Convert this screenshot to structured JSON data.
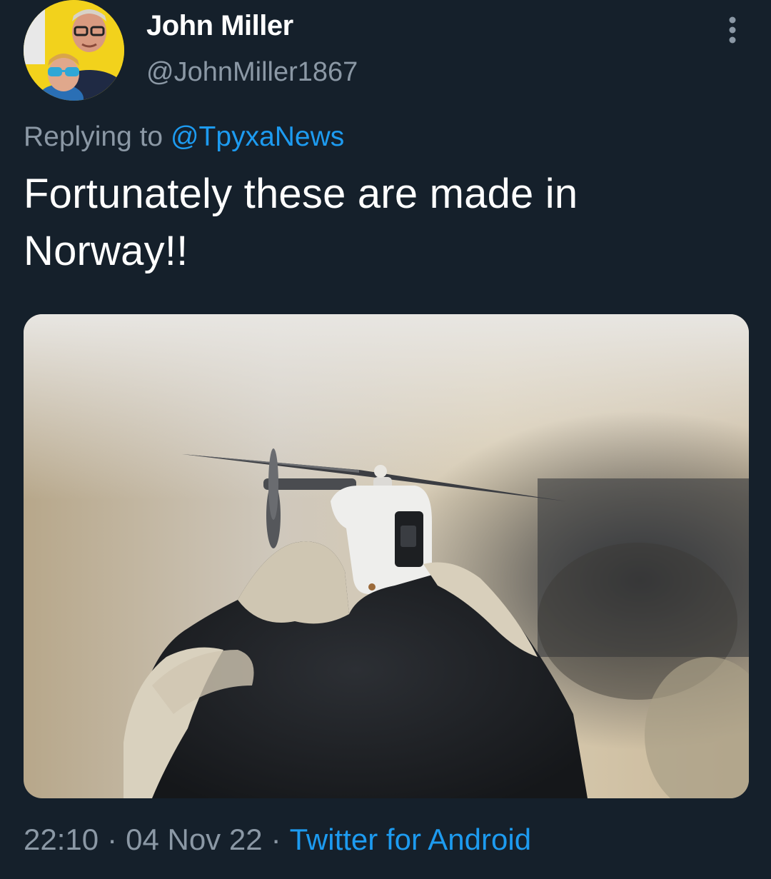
{
  "tweet": {
    "author": {
      "display_name": "John Miller",
      "handle": "@JohnMiller1867"
    },
    "replying_prefix": "Replying to",
    "replying_to": "@TpyxaNews",
    "text_line1": "Fortunately these are made in",
    "text_line2": "Norway!!",
    "time": "22:10",
    "separator": "·",
    "date": "04 Nov 22",
    "source": "Twitter for Android"
  },
  "icons": {
    "more": "more-vertical-icon"
  },
  "colors": {
    "background": "#15202b",
    "primary_text": "#ffffff",
    "secondary_text": "#8b98a5",
    "accent": "#1d9bf0"
  }
}
